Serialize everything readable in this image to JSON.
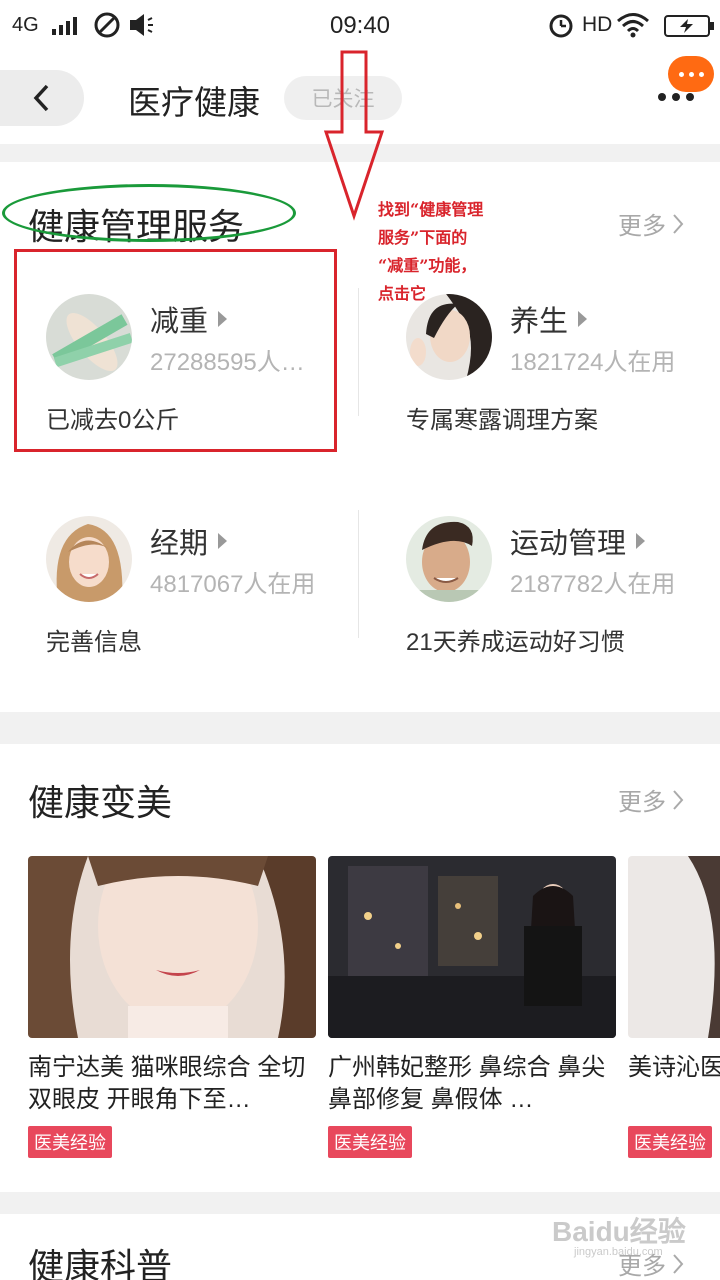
{
  "status_bar": {
    "network": "4G",
    "time": "09:40",
    "hd": "HD"
  },
  "nav": {
    "title": "医疗健康",
    "follow_label": "已关注"
  },
  "health_mgmt": {
    "title": "健康管理服务",
    "more": "更多",
    "items": [
      {
        "name": "减重",
        "users": "27288595人…",
        "desc": "已减去0公斤"
      },
      {
        "name": "养生",
        "users": "1821724人在用",
        "desc": "专属寒露调理方案"
      },
      {
        "name": "经期",
        "users": "4817067人在用",
        "desc": "完善信息"
      },
      {
        "name": "运动管理",
        "users": "2187782人在用",
        "desc": "21天养成运动好习惯"
      }
    ]
  },
  "beauty": {
    "title": "健康变美",
    "more": "更多",
    "items": [
      {
        "text": "南宁达美 猫咪眼综合 全切 双眼皮 开眼角下至…",
        "tag": "医美经验"
      },
      {
        "text": "广州韩妃整形 鼻综合 鼻尖 鼻部修复 鼻假体 …",
        "tag": "医美经验"
      },
      {
        "text": "美诗沁医 黑眼圈 祛",
        "tag": "医美经验"
      }
    ]
  },
  "science": {
    "title": "健康科普",
    "more": "更多"
  },
  "annotation": {
    "lines": [
      "找到“健康管理",
      "服务”下面的",
      "“减重”功能，",
      "点击它"
    ]
  },
  "watermark": {
    "main": "Baidu经验",
    "sub": "jingyan.baidu.com"
  }
}
